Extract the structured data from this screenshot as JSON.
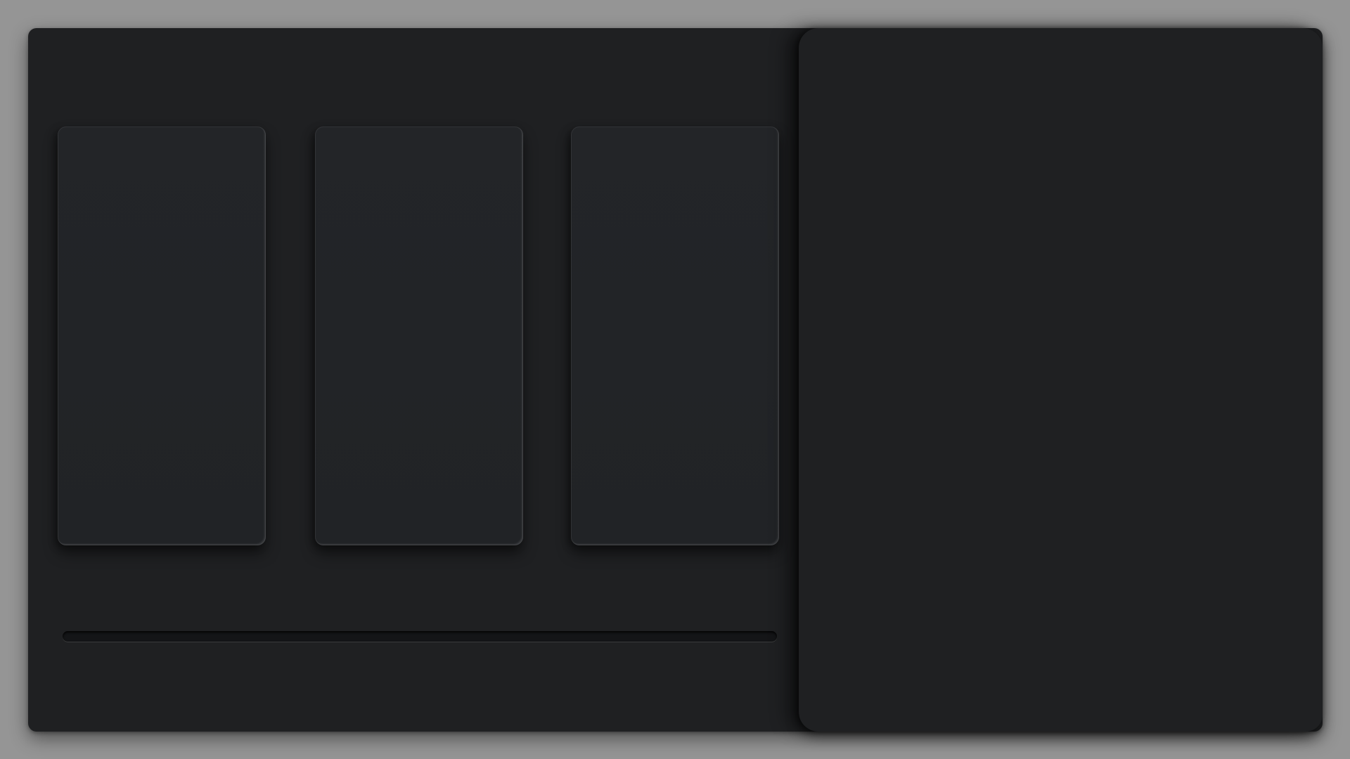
{
  "colors": {
    "backdrop": "#959595",
    "window_background": "#1f2022",
    "card_background": "#222427",
    "track_background": "#141517"
  },
  "cards": [
    {
      "id": "card-1"
    },
    {
      "id": "card-2"
    },
    {
      "id": "card-3"
    }
  ]
}
